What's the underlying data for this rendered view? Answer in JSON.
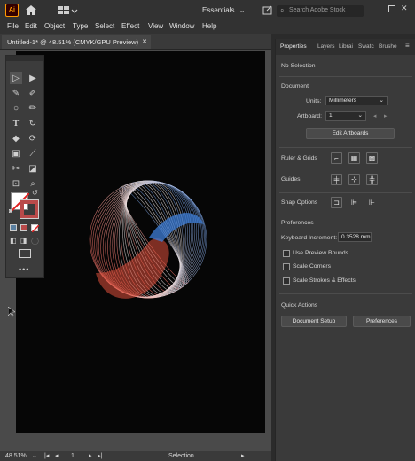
{
  "app": {
    "logo": "Ai"
  },
  "topbar": {
    "workspace": "Essentials",
    "search_placeholder": "Search Adobe Stock"
  },
  "menu": [
    "File",
    "Edit",
    "Object",
    "Type",
    "Select",
    "Effect",
    "View",
    "Window",
    "Help"
  ],
  "document_tab": {
    "title": "Untitled-1* @ 48.51% (CMYK/GPU Preview)",
    "close": "✕"
  },
  "status": {
    "zoom": "48.51%",
    "page": "1",
    "tool": "Selection"
  },
  "panel": {
    "tabs": [
      "Properties",
      "Layers",
      "Librai",
      "Swatc",
      "Brushe"
    ],
    "selection": "No Selection",
    "document_heading": "Document",
    "units_label": "Units:",
    "units_value": "Millimeters",
    "artboard_label": "Artboard:",
    "artboard_value": "1",
    "edit_artboards": "Edit Artboards",
    "ruler_grids": "Ruler & Grids",
    "guides": "Guides",
    "snap_options": "Snap Options",
    "preferences_heading": "Preferences",
    "keyboard_increment_label": "Keyboard Increment:",
    "keyboard_increment_value": "0.3528 mm",
    "checkboxes": [
      "Use Preview Bounds",
      "Scale Corners",
      "Scale Strokes & Effects"
    ],
    "quick_actions": "Quick Actions",
    "document_setup": "Document Setup",
    "preferences_button": "Preferences"
  },
  "colors": {
    "accent_red": "#e0503c",
    "accent_blue": "#3f7fd8",
    "artboard": "#060606"
  }
}
